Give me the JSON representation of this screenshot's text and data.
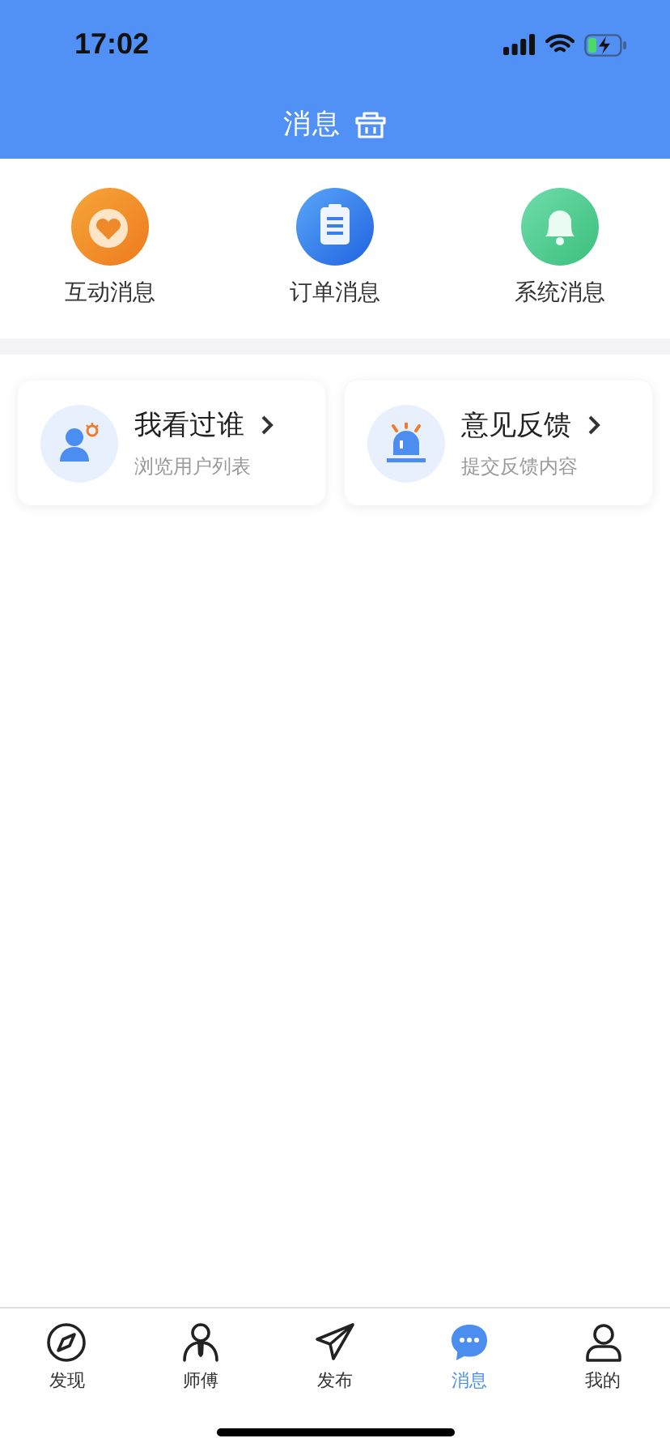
{
  "status_bar": {
    "time": "17:02"
  },
  "header": {
    "title": "消息"
  },
  "quick_entries": [
    {
      "label": "互动消息"
    },
    {
      "label": "订单消息"
    },
    {
      "label": "系统消息"
    }
  ],
  "cards": [
    {
      "title": "我看过谁",
      "subtitle": "浏览用户列表"
    },
    {
      "title": "意见反馈",
      "subtitle": "提交反馈内容"
    }
  ],
  "tab_bar": [
    {
      "label": "发现",
      "selected": false
    },
    {
      "label": "师傅",
      "selected": false
    },
    {
      "label": "发布",
      "selected": false
    },
    {
      "label": "消息",
      "selected": true
    },
    {
      "label": "我的",
      "selected": false
    }
  ]
}
